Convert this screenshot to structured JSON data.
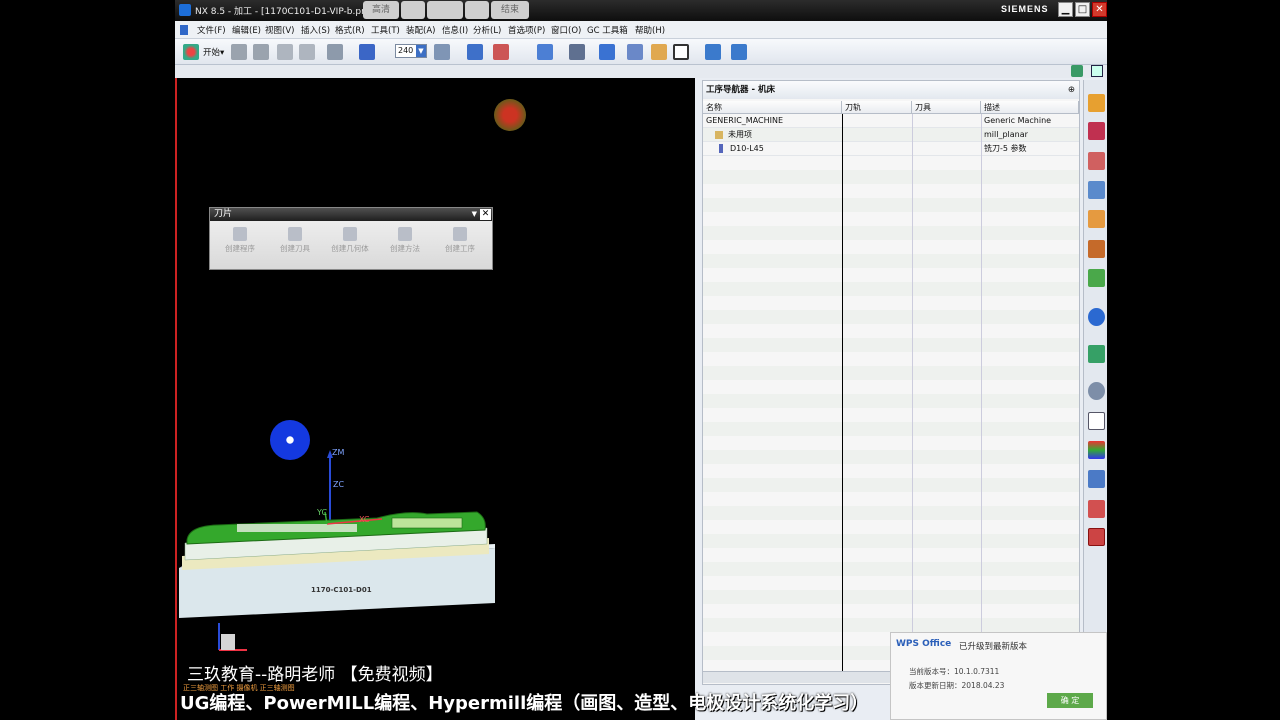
{
  "window": {
    "title": "NX 8.5 - 加工 - [1170C101-D1-VIP-b.prt ]",
    "brand": "SIEMENS",
    "ghost_tabs": [
      "高清",
      "",
      "",
      "",
      "结束"
    ],
    "min": "▁",
    "max": "□",
    "close": "✕"
  },
  "menu": [
    "文件(F)",
    "编辑(E)",
    "视图(V)",
    "插入(S)",
    "格式(R)",
    "工具(T)",
    "装配(A)",
    "信息(I)",
    "分析(L)",
    "首选项(P)",
    "窗口(O)",
    "GC 工具箱",
    "帮助(H)"
  ],
  "toolbar": {
    "start_label": "开始▾",
    "zoom": "240"
  },
  "popup": {
    "title": "刀片",
    "close": "✕",
    "items": [
      "创建程序",
      "创建刀具",
      "创建几何体",
      "创建方法",
      "创建工序"
    ]
  },
  "viewport": {
    "axis": {
      "zm": "ZM",
      "zc": "ZC",
      "ym": "YC",
      "xc": "XC",
      "xm": "XM"
    },
    "part_label": "1170-C101-D01",
    "watermark": "三玖教育--路明老师  【免费视频】",
    "status_small": "正三轴测图 工作 摄像机 正三轴测图"
  },
  "navigator": {
    "title": "工序导航器 - 机床",
    "pin": "⊕",
    "columns": [
      "名称",
      "刀轨",
      "刀具",
      "描述"
    ],
    "rows": [
      {
        "name": "GENERIC_MACHINE",
        "desc": "Generic Machine"
      },
      {
        "name": "未用项",
        "desc": "mill_planar"
      },
      {
        "name": "D10-L45",
        "desc": "铣刀-5 参数"
      }
    ]
  },
  "wps": {
    "logo": "WPS Office",
    "headline": "已升级到最新版本",
    "version": "当前版本号：10.1.0.7311",
    "date": "版本更新日期：2018.04.23",
    "ok": "确 定"
  },
  "subtitle": "UG编程、PowerMILL编程、Hypermill编程（画图、造型、电极设计系统化学习）"
}
